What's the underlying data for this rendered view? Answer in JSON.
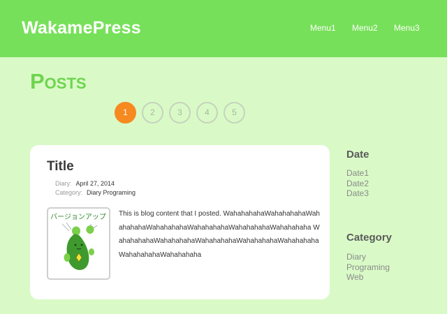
{
  "brand": "WakamePress",
  "nav": [
    "Menu1",
    "Menu2",
    "Menu3"
  ],
  "posts_heading": "Posts",
  "pagination": {
    "pages": [
      "1",
      "2",
      "3",
      "4",
      "5"
    ],
    "current": "1"
  },
  "post": {
    "title": "Title",
    "diary_key": "Diary:",
    "diary_value": "April 27, 2014",
    "category_key": "Category:",
    "category_value": "Diary Programing",
    "thumbnail_text": "バージョンアップ",
    "content": "This is blog content that I posted. WahahahahaWahahahahaWahahahahaWahahahahaWahahahahaWahahahahaWahahahaha WahahahahaWahahahahaWahahahahaWahahahahaWahahahahaWahahahahaWahahahaha"
  },
  "sidebar": {
    "date_heading": "Date",
    "dates": [
      "Date1",
      "Date2",
      "Date3"
    ],
    "category_heading": "Category",
    "categories": [
      "Diary",
      "Programing",
      "Web"
    ]
  },
  "colors": {
    "header": "#77e05a",
    "background": "#d9fac7",
    "accent": "#f6891f",
    "heading_green": "#6fd44f"
  }
}
